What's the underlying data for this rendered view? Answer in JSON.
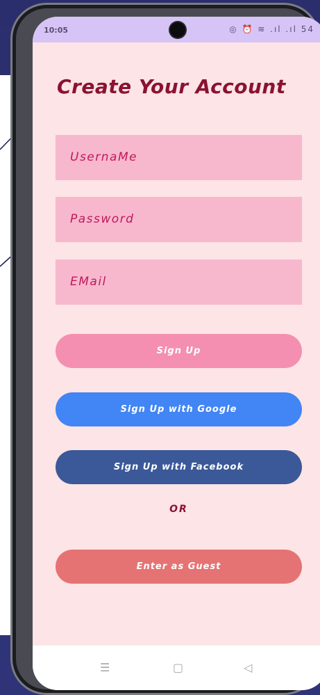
{
  "status": {
    "time": "10:05",
    "icons": "◎ ⏰ ≋ .ıl .ıl 54"
  },
  "title": "Create Your Account",
  "fields": {
    "username_placeholder": "UsernaMe",
    "password_placeholder": "Password",
    "email_placeholder": "EMail"
  },
  "buttons": {
    "sign_up": "Sign Up",
    "google": "Sign Up with Google",
    "facebook": "Sign Up with Facebook",
    "guest": "Enter as Guest"
  },
  "or_text": "OR",
  "nav": {
    "recents": "☰",
    "home": "▢",
    "back": "◁"
  },
  "colors": {
    "title": "#8a1232",
    "field_bg": "#f7b8ce",
    "sign_up": "#f48fb1",
    "google": "#4285f4",
    "facebook": "#3b5998",
    "guest": "#e57373"
  }
}
